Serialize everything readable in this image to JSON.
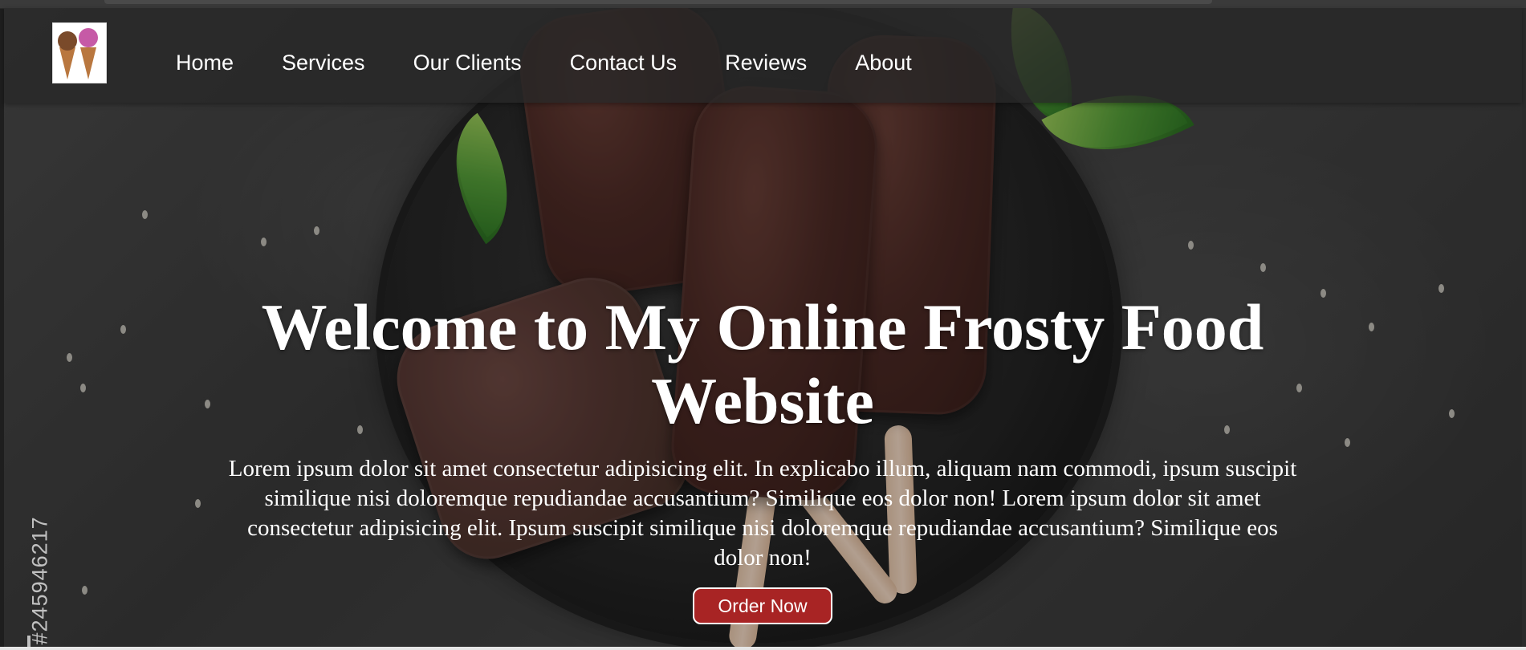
{
  "nav": {
    "logo_alt": "ice cream cones logo",
    "links": [
      {
        "label": "Home"
      },
      {
        "label": "Services"
      },
      {
        "label": "Our Clients"
      },
      {
        "label": "Contact Us"
      },
      {
        "label": "Reviews"
      },
      {
        "label": "About"
      }
    ]
  },
  "hero": {
    "title": "Welcome to My Online Frosty Food Website",
    "description": "Lorem ipsum dolor sit amet consectetur adipisicing elit. In explicabo illum, aliquam nam commodi, ipsum suscipit similique nisi doloremque repudiandae accusantium? Similique eos dolor non! Lorem ipsum dolor sit amet consectetur adipisicing elit. Ipsum suscipit similique nisi doloremque repudiandae accusantium? Similique eos dolor non!",
    "order_button": "Order Now"
  },
  "watermark": {
    "stock_id": "#245946217"
  },
  "colors": {
    "button": "#a82424",
    "navbar_bg": "#282828",
    "text": "#ffffff"
  }
}
